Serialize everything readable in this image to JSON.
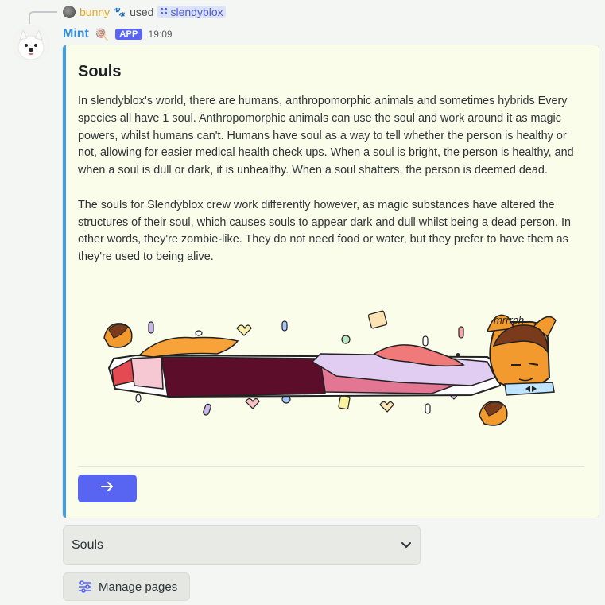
{
  "reply": {
    "user": "bunny",
    "action": "used",
    "command": "slendyblox",
    "icons": [
      "avatar-small",
      "paw-icon",
      "command-grid-icon"
    ]
  },
  "message": {
    "author": "Mint",
    "author_emoji": "🍭",
    "badge": "APP",
    "timestamp": "19:09"
  },
  "embed": {
    "accent_color": "#3ea0e8",
    "title": "Souls",
    "paragraphs": [
      "In slendyblox's world, there are humans, anthropomorphic animals and sometimes hybrids Every species all have 1 soul. Anthropomorphic animals can use the soul and work around it as magic powers, whilst humans can't. Humans have soul as a way to tell whether the person is healthy or not, allowing for easier medical health check ups. When a soul is bright, the person is healthy, and when a soul is dull or dark, it is unhealthy. When a soul shatters, the person is deemed dead.",
      "The souls for Slendyblox crew work differently however, as magic substances have altered the structures of their soul, which causes souls to appear dark and dull whilst being a dead person. In other words, they're zombie-like. They do not need food or water, but they prefer to have them as they're used to being alive."
    ],
    "image_text": "mrrrph",
    "next_button_icon": "arrow-right-icon"
  },
  "select": {
    "value": "Souls",
    "icon": "chevron-down-icon"
  },
  "manage_button": {
    "label": "Manage pages",
    "icon": "sliders-icon"
  },
  "colors": {
    "blurple": "#5865f2",
    "author": "#3a8ed8",
    "reply_user": "#e0a92c",
    "embed_bg": "#fbfdeb"
  }
}
